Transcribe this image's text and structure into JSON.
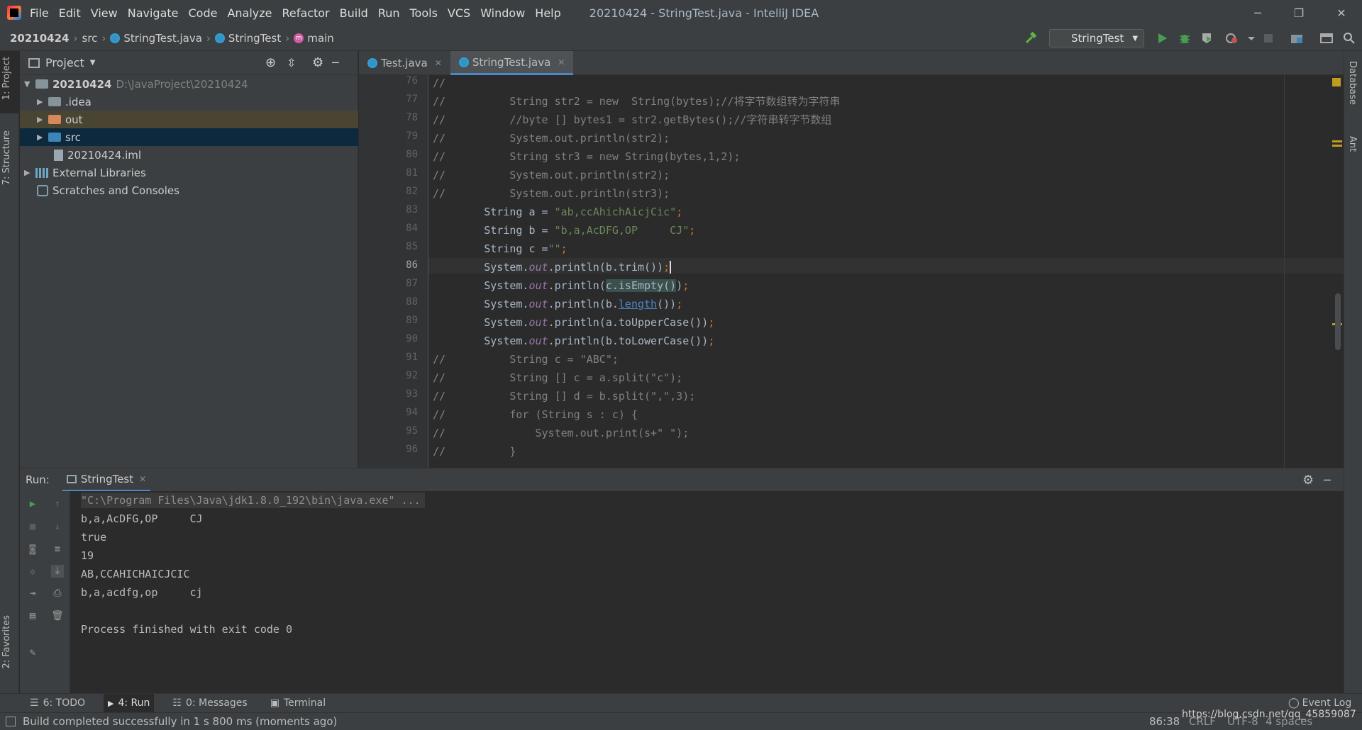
{
  "titlebar": {
    "menu": [
      "File",
      "Edit",
      "View",
      "Navigate",
      "Code",
      "Analyze",
      "Refactor",
      "Build",
      "Run",
      "Tools",
      "VCS",
      "Window",
      "Help"
    ],
    "title": "20210424 - StringTest.java - IntelliJ IDEA"
  },
  "navbar": {
    "crumbs": [
      "20210424",
      "src",
      "StringTest.java",
      "StringTest",
      "main"
    ],
    "run_config": "StringTest"
  },
  "left_strip": {
    "project_tab": "1: Project",
    "structure_tab": "7: Structure",
    "favorites_tab": "2: Favorites"
  },
  "right_strip": {
    "database_tab": "Database",
    "ant_tab": "Ant"
  },
  "project": {
    "header": "Project",
    "tree": [
      {
        "label": "20210424",
        "extra": "D:\\JavaProject\\20210424"
      },
      {
        "label": ".idea"
      },
      {
        "label": "out"
      },
      {
        "label": "src"
      },
      {
        "label": "20210424.iml"
      },
      {
        "label": "External Libraries"
      },
      {
        "label": "Scratches and Consoles"
      }
    ]
  },
  "editor": {
    "tabs": [
      "Test.java",
      "StringTest.java"
    ],
    "current_line": 86,
    "line_numbers": [
      "76",
      "77",
      "78",
      "79",
      "80",
      "81",
      "82",
      "83",
      "84",
      "85",
      "86",
      "87",
      "88",
      "89",
      "90",
      "91",
      "92",
      "93",
      "94",
      "95",
      "96"
    ]
  },
  "run": {
    "label": "Run:",
    "tab": "StringTest",
    "output": [
      "\"C:\\Program Files\\Java\\jdk1.8.0_192\\bin\\java.exe\" ...",
      "b,a,AcDFG,OP     CJ",
      "true",
      "19",
      "AB,CCAHICHAICJCIC",
      "b,a,acdfg,op     cj",
      "",
      "Process finished with exit code 0"
    ]
  },
  "bottom_tabs": [
    "6: TODO",
    "4: Run",
    "0: Messages",
    "Terminal"
  ],
  "event_log": "Event Log",
  "status": {
    "message": "Build completed successfully in 1 s 800 ms (moments ago)",
    "position": "86:38",
    "line_sep": "CRLF",
    "encoding": "UTF-8",
    "indent": "4 spaces",
    "watermark": "https://blog.csdn.net/qq_45859087"
  }
}
